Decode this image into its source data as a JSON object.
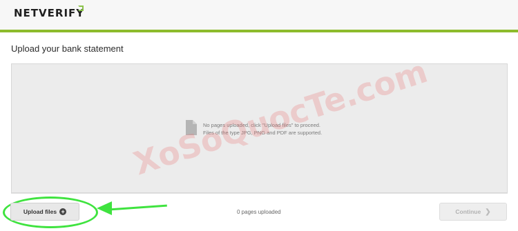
{
  "header": {
    "brand": "NETVERIFY"
  },
  "page": {
    "title": "Upload your bank statement"
  },
  "dropzone": {
    "line1": "No pages uploaded, click \"Upload files\" to proceed.",
    "line2": "Files of the type JPG, PNG and PDF are supported.",
    "icon": "document-icon"
  },
  "watermark": "XoSoQuocTe.com",
  "footer": {
    "upload_label": "Upload files",
    "pages_status": "0 pages uploaded",
    "continue_label": "Continue"
  },
  "colors": {
    "accent": "#8dbb2c",
    "annotation": "#3fe33f"
  }
}
